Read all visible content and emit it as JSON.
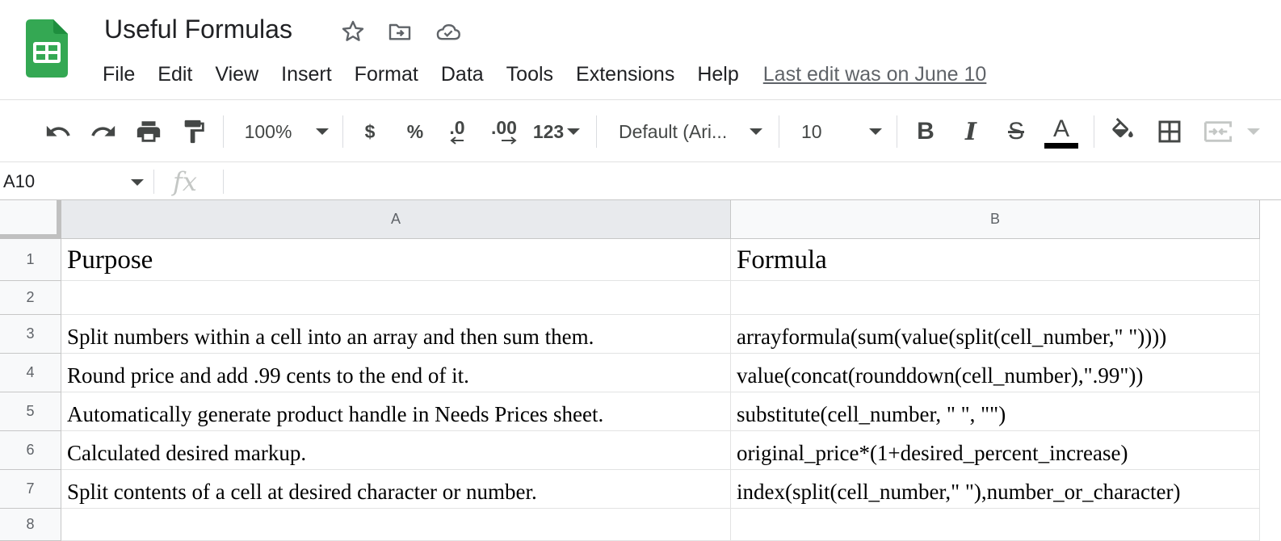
{
  "app": {
    "title": "Useful Formulas",
    "accent_color": "#1a73e8",
    "logo_color": "#34a853",
    "icons": [
      "sheets-logo-icon",
      "star-icon",
      "move-to-folder-icon",
      "cloud-status-icon"
    ]
  },
  "menu": {
    "items": [
      "File",
      "Edit",
      "View",
      "Insert",
      "Format",
      "Data",
      "Tools",
      "Extensions",
      "Help"
    ],
    "last_edit": "Last edit was on June 10"
  },
  "toolbar": {
    "zoom": "100%",
    "currency": "$",
    "percent": "%",
    "decrease_decimal": ".0",
    "increase_decimal": ".00",
    "number_format": "123",
    "font": "Default (Ari...",
    "font_size": "10",
    "bold": "B",
    "italic": "I",
    "strikethrough": "S",
    "text_color": "A",
    "text_color_value": "#000000",
    "icons": [
      "undo-icon",
      "redo-icon",
      "print-icon",
      "paint-format-icon",
      "fill-color-icon",
      "borders-icon",
      "merge-cells-icon"
    ]
  },
  "formula_bar": {
    "cell_ref": "A10",
    "fx": "fx",
    "value": ""
  },
  "grid": {
    "columns": [
      "A",
      "B"
    ],
    "selected_column": "A",
    "rows": [
      {
        "num": "1",
        "a": "Purpose",
        "b": "Formula"
      },
      {
        "num": "2",
        "a": "",
        "b": ""
      },
      {
        "num": "3",
        "a": "Split numbers within a cell into an array and then sum them.",
        "b": "arrayformula(sum(value(split(cell_number,\" \"))))"
      },
      {
        "num": "4",
        "a": "Round price and add .99 cents to the end of it.",
        "b": "value(concat(rounddown(cell_number),\".99\"))"
      },
      {
        "num": "5",
        "a": "Automatically generate product handle in Needs Prices sheet.",
        "b": "substitute(cell_number, \" \", \"\")"
      },
      {
        "num": "6",
        "a": "Calculated desired markup.",
        "b": "original_price*(1+desired_percent_increase)"
      },
      {
        "num": "7",
        "a": "Split contents of a cell at desired character or number.",
        "b": "index(split(cell_number,\" \"),number_or_character)"
      },
      {
        "num": "8",
        "a": "",
        "b": ""
      }
    ]
  }
}
